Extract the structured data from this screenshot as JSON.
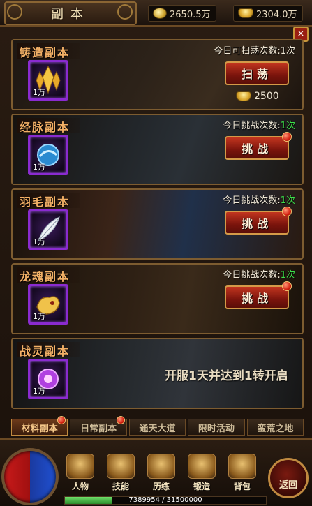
{
  "header": {
    "title": "副本",
    "currency_coins": "2650.5万",
    "currency_ingots": "2304.0万",
    "close_label": "×"
  },
  "dungeons": [
    {
      "name": "铸造副本",
      "count_label": "今日可扫荡次数:",
      "count_value": "1次",
      "action_label": "扫荡",
      "item_qty": "1万",
      "cost": "2500",
      "icon": "gold-crystal-icon",
      "has_badge": false
    },
    {
      "name": "经脉副本",
      "count_label": "今日挑战次数:",
      "count_value": "1次",
      "action_label": "挑战",
      "item_qty": "1万",
      "icon": "blue-orb-icon",
      "has_badge": true
    },
    {
      "name": "羽毛副本",
      "count_label": "今日挑战次数:",
      "count_value": "1次",
      "action_label": "挑战",
      "item_qty": "1万",
      "icon": "white-feather-icon",
      "has_badge": true
    },
    {
      "name": "龙魂副本",
      "count_label": "今日挑战次数:",
      "count_value": "1次",
      "action_label": "挑战",
      "item_qty": "1万",
      "icon": "gold-dragon-soul-icon",
      "has_badge": true
    },
    {
      "name": "战灵副本",
      "locked_text": "开服1天并达到1转开启",
      "item_qty": "1万",
      "icon": "purple-spirit-icon"
    }
  ],
  "tabs": [
    {
      "label": "材料副本",
      "active": true,
      "badge": true
    },
    {
      "label": "日常副本",
      "active": false,
      "badge": true
    },
    {
      "label": "通天大道",
      "active": false,
      "badge": false
    },
    {
      "label": "限时活动",
      "active": false,
      "badge": false
    },
    {
      "label": "蛮荒之地",
      "active": false,
      "badge": false
    }
  ],
  "menu": [
    {
      "label": "人物",
      "icon": "character-icon"
    },
    {
      "label": "技能",
      "icon": "skill-book-icon"
    },
    {
      "label": "历练",
      "icon": "training-icon"
    },
    {
      "label": "锻造",
      "icon": "anvil-icon"
    },
    {
      "label": "背包",
      "icon": "backpack-icon"
    }
  ],
  "back_label": "返回",
  "exp": {
    "text": "7389954 / 31500000",
    "fraction": 0.2346
  },
  "colors": {
    "accent_gold": "#f2b066",
    "count_green": "#3de04a",
    "button_red": "#c2351f",
    "frame_purple": "#8a2bd0"
  }
}
